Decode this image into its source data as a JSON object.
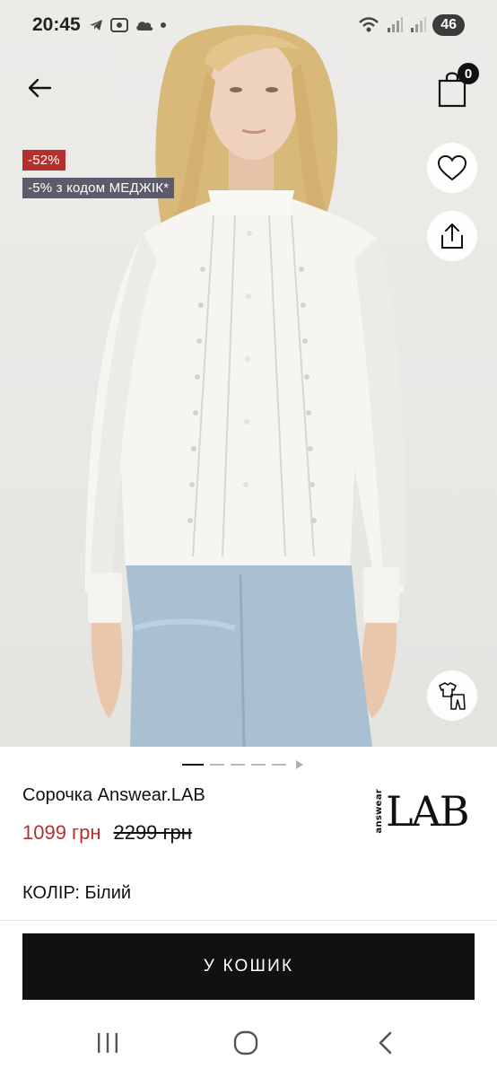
{
  "status_bar": {
    "time": "20:45",
    "network_badge": "46"
  },
  "header": {
    "cart_count": "0"
  },
  "product": {
    "discount_tag": "-52%",
    "promo_tag": "-5% з кодом МЕДЖІК*",
    "title": "Сорочка Answear.LAB",
    "price_current": "1099 грн",
    "price_old": "2299 грн",
    "color_label": "КОЛІР:",
    "color_value": "Білий",
    "brand": {
      "side_text": "answear",
      "main_text": "LAB"
    }
  },
  "gallery": {
    "page_count": 6,
    "active_page": 1
  },
  "actions": {
    "add_to_cart": "У КОШИК"
  },
  "colors": {
    "sale_red": "#b3302f",
    "promo_gray": "#5c5b6b",
    "cta_black": "#111111"
  },
  "icons": [
    "back-arrow-icon",
    "shopping-bag-icon",
    "heart-icon",
    "share-icon",
    "outfit-icon",
    "recents-icon",
    "home-icon",
    "nav-back-icon"
  ]
}
